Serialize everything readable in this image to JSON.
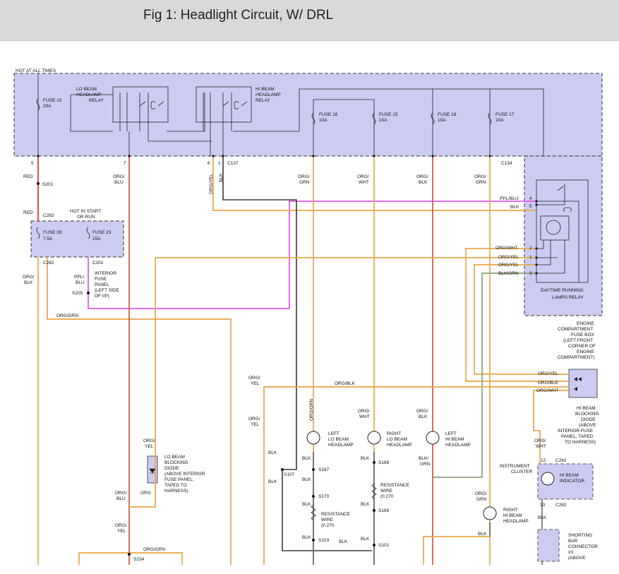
{
  "header": {
    "title": "Fig 1: Headlight Circuit, W/ DRL"
  },
  "texts": {
    "hot_all_times": "HOT AT ALL TIMES",
    "fuse10": "FUSE 10",
    "fuse10_a": "20A",
    "lo_relay_1": "LO BEAM",
    "lo_relay_2": "HEADLAMP",
    "lo_relay_3": "RELAY",
    "hi_relay_1": "HI BEAM",
    "hi_relay_2": "HEADLAMP",
    "hi_relay_3": "RELAY",
    "fuse16": "FUSE 16",
    "fuse16_a": "10A",
    "fuse15": "FUSE 15",
    "fuse15_a": "10A",
    "fuse18": "FUSE 18",
    "fuse18_a": "10A",
    "fuse17": "FUSE 17",
    "fuse17_a": "10A",
    "pin5": "5",
    "pin7": "7",
    "pin6": "6",
    "pin1": "1",
    "c137": "C137",
    "c134": "C134",
    "red1": "RED",
    "s201": "S201",
    "red2": "RED",
    "c282a": "C282",
    "hot_start_1": "HOT IN START",
    "hot_start_2": "OR RUN",
    "fuse26": "FUSE 26",
    "fuse26_a": "7.5A",
    "fuse23": "FUSE 23",
    "fuse23_a": "15A",
    "c282b": "C282",
    "c201": "C201",
    "org_blk_l1": "ORG/",
    "org_blk_l2": "BLK",
    "ppl_blu_1": "PPL/",
    "ppl_blu_2": "BLU",
    "s205": "S205",
    "ifp_1": "INTERIOR",
    "ifp_2": "FUSE",
    "ifp_3": "PANEL",
    "ifp_4": "(LEFT SIDE",
    "ifp_5": "OF I/P)",
    "org_blu_1": "ORG/",
    "org_blu_2": "BLU",
    "org_yel_v": "ORG/YEL",
    "blk_v": "BLK",
    "org_grn_1": "ORG/",
    "org_grn_2": "GRN",
    "org_wht_1": "ORG/",
    "org_wht_2": "WHT",
    "org_blk_m1": "ORG/",
    "org_blk_m2": "BLK",
    "org_grn_r1": "ORG/",
    "org_grn_r2": "GRN",
    "ppl_blu_h": "PPL/BLU",
    "blk_h": "BLK",
    "org_wht_h": "ORG/WHT",
    "org_yel_h1": "ORG/YEL",
    "org_yel_h2": "ORG/YEL",
    "blk_grn_h": "BLK/GRN",
    "p4": "4",
    "p5": "5",
    "p2": "2",
    "p1": "1",
    "p3": "3",
    "drl_1": "DAYTIME RUNNING",
    "drl_2": "LAMPS RELAY",
    "org_grn_h": "ORG/GRN",
    "ecfb_1": "ENGINE",
    "ecfb_2": "COMPARTMENT",
    "ecfb_3": "FUSE BOX",
    "ecfb_4": "(LEFT FRONT",
    "ecfb_5": "CORNER OF",
    "ecfb_6": "ENGINE",
    "ecfb_7": "COMPARTMENT)",
    "org_yel_d": "ORG/YEL",
    "org_blk_d": "ORG/BLK",
    "org_wht_d": "ORG/WHT",
    "org_yel_l1": "ORG/",
    "org_yel_l2": "YEL",
    "org_blk_long": "ORG/BLK",
    "org_grn_vt": "ORG/GRN",
    "org_wht_v1": "ORG/",
    "org_wht_v2": "WHT",
    "org_blk_v1": "ORG/",
    "org_blk_v2": "BLK",
    "hbbd_1": "HI BEAM",
    "hbbd_2": "BLOCKING",
    "hbbd_3": "DIODE",
    "hbbd_4": "(ABOVE",
    "hbbd_5": "INTERIOR FUSE",
    "hbbd_6": "PANEL, TAPED",
    "hbbd_7": "TO HARNESS)",
    "org_yel_l3": "ORG/",
    "org_yel_l4": "YEL",
    "lbbd_1": "LO BEAM",
    "lbbd_2": "BLOCKING",
    "lbbd_3": "DIODE",
    "lbbd_4": "(ABOVE INTERIOR",
    "lbbd_5": "FUSE PANEL,",
    "lbbd_6": "TAPED TO",
    "lbbd_7": "HARNESS)",
    "org_yel_l5": "ORG/",
    "org_yel_l6": "YEL",
    "left_lo_1": "LEFT",
    "left_lo_2": "LO BEAM",
    "left_lo_3": "HEADLAMP",
    "right_lo_1": "RIGHT",
    "right_lo_2": "LO BEAM",
    "right_lo_3": "HEADLAMP",
    "left_hi_1": "LEFT",
    "left_hi_2": "HI BEAM",
    "left_hi_3": "HEADLAMP",
    "org_wht_v3": "ORG/",
    "org_wht_v4": "WHT",
    "inst_1": "INSTRUMENT",
    "inst_2": "CLUSTER",
    "p12": "12",
    "c262a": "C262",
    "hbi_1": "HI BEAM",
    "hbi_2": "INDICATOR",
    "p13": "13",
    "c262b": "C262",
    "blk_a": "BLK",
    "s107": "S107",
    "blk_b": "BLK",
    "blk_c": "BLK",
    "s167": "S167",
    "blk_d": "BLK",
    "s170": "S170",
    "blk_e": "BLK",
    "rw1_1": "RESISTANCE",
    "rw1_2": "WIRE",
    "rw1_3": "(0.270",
    "blk_f": "BLK",
    "s103": "S103",
    "blk_g": "BLK",
    "blk_h2": "BLK",
    "s168": "S168",
    "rw2_1": "RESISTANCE",
    "rw2_2": "WIRE",
    "rw2_3": "(0.270",
    "blk_i": "BLK",
    "s169": "S169",
    "blk_j": "BLK",
    "s101": "S101",
    "blk_grn_v1": "BLK/",
    "blk_grn_v2": "GRN",
    "org_grn_r3": "ORG/",
    "org_grn_r4": "GRN",
    "right_hi_1": "RIGHT",
    "right_hi_2": "HI BEAM",
    "right_hi_3": "HEADLAMP",
    "blk_k": "BLK",
    "blk_l": "BLK",
    "org_blu_3": "ORG/",
    "org_blu_4": "BLU",
    "org_d": "ORG",
    "org_yel_l7": "ORG/",
    "org_yel_l8": "YEL",
    "org_grn_b": "ORG/GRN",
    "s234": "S234",
    "sbc_1": "SHORTING",
    "sbc_2": "BAR",
    "sbc_3": "CONNECTOR",
    "sbc_4": "#3",
    "sbc_5": "(ABOVE"
  },
  "colors": {
    "orange_wire": "#e9a64a",
    "red_wire": "#e03030",
    "magenta_wire": "#e05ae8",
    "black_wire": "#3a3a3a",
    "green_wire": "#8aa07a",
    "brown_wire": "#c45d3a",
    "component_fill": "#ccccf2"
  }
}
